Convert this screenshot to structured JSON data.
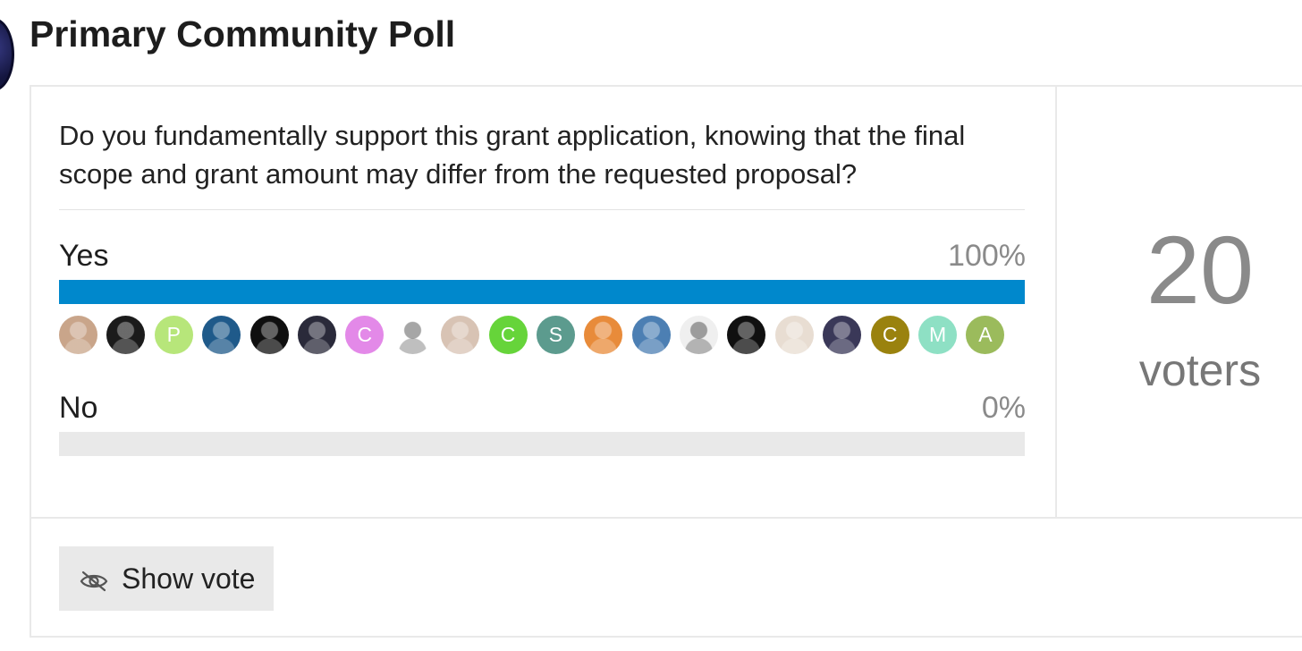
{
  "poll": {
    "title": "Primary Community Poll",
    "question": "Do you fundamentally support this grant application, knowing that the final scope and grant amount may differ from the requested proposal?",
    "options": [
      {
        "label": "Yes",
        "percent_text": "100%",
        "fill": 1.0
      },
      {
        "label": "No",
        "percent_text": "0%",
        "fill": 0.0
      }
    ],
    "voter_count": "20",
    "voter_label": "voters",
    "show_vote_label": "Show vote",
    "colors": {
      "bar_fill": "#0088cc",
      "bar_track": "#e9e9e9",
      "button_bg": "#e9e9e9"
    }
  },
  "yes_voters": [
    {
      "letter": "",
      "color": "#c9a58a",
      "icon": "avatar-photo"
    },
    {
      "letter": "",
      "color": "#1b1b1b",
      "icon": "avatar-photo"
    },
    {
      "letter": "P",
      "color": "#b7e67a",
      "icon": "avatar-letter"
    },
    {
      "letter": "",
      "color": "#1f5a8a",
      "icon": "avatar-photo"
    },
    {
      "letter": "",
      "color": "#0f0f0f",
      "icon": "avatar-photo"
    },
    {
      "letter": "",
      "color": "#2a2a3a",
      "icon": "avatar-photo"
    },
    {
      "letter": "C",
      "color": "#e389e8",
      "icon": "avatar-letter"
    },
    {
      "letter": "",
      "color": "#ffffff",
      "icon": "avatar-photo"
    },
    {
      "letter": "",
      "color": "#d8c3b4",
      "icon": "avatar-photo"
    },
    {
      "letter": "C",
      "color": "#66d43a",
      "icon": "avatar-letter"
    },
    {
      "letter": "S",
      "color": "#5c9b8e",
      "icon": "avatar-letter"
    },
    {
      "letter": "",
      "color": "#e88b3a",
      "icon": "avatar-photo"
    },
    {
      "letter": "",
      "color": "#4c7fb3",
      "icon": "avatar-photo"
    },
    {
      "letter": "",
      "color": "#efefef",
      "icon": "avatar-photo"
    },
    {
      "letter": "",
      "color": "#101010",
      "icon": "avatar-photo"
    },
    {
      "letter": "",
      "color": "#e8ddd2",
      "icon": "avatar-photo"
    },
    {
      "letter": "",
      "color": "#3a3858",
      "icon": "avatar-photo"
    },
    {
      "letter": "C",
      "color": "#9a820e",
      "icon": "avatar-letter"
    },
    {
      "letter": "M",
      "color": "#8ee0c4",
      "icon": "avatar-letter"
    },
    {
      "letter": "A",
      "color": "#9bbb5c",
      "icon": "avatar-letter"
    }
  ]
}
